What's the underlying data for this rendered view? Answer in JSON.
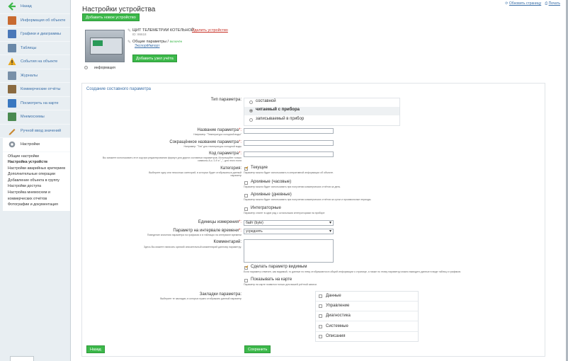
{
  "sidebar": {
    "back": "Назад",
    "items": [
      {
        "label": "Информация об объекте",
        "color": "#c86a30"
      },
      {
        "label": "Графики и диаграммы",
        "color": "#4a78b8"
      },
      {
        "label": "Таблицы",
        "color": "#6a88a8"
      },
      {
        "label": "События на объекте",
        "color": "#e8a820"
      },
      {
        "label": "Журналы",
        "color": "#7890a8"
      },
      {
        "label": "Коммерческие отчёты",
        "color": "#8a6a40"
      },
      {
        "label": "Посмотреть на карте",
        "color": "#3a78c0"
      },
      {
        "label": "Мнемосхемы",
        "color": "#4a8a50"
      },
      {
        "label": "Ручной ввод значений",
        "color": "#c88830"
      }
    ],
    "settings": "Настройки",
    "submenu": [
      "Общие настройки",
      "Настройка устройств",
      "Настройки аварийных критериев",
      "Дополнительные операции",
      "Добавление объекта в группу",
      "Настройки доступа",
      "Настройка мнемосхем и",
      "коммерческих отчётов",
      "Фотографии и документация"
    ]
  },
  "header": {
    "title": "Настройки устройства",
    "refresh": "Обновить страницу",
    "print": "Печать"
  },
  "device": {
    "add_device": "Добавить новое устройство",
    "name": "ЩИТ ТЕЛЕМЕТРИИ КОТЕЛЬНОЙ",
    "id": "ID: 86618",
    "delete": "Удалить устройство",
    "common_params": "Общие параметры",
    "enabled": "включён",
    "export": "Экспорт",
    "import": "Импорт",
    "add_node": "Добавить узел учёта",
    "info": "информация"
  },
  "form": {
    "title": "Создание составного параметра",
    "type_label": "Тип параметра:",
    "types": [
      "составной",
      "читаемый с прибора",
      "записываемый в прибор"
    ],
    "name_label": "Название параметра",
    "name_hint": "Например: \"Температура холодной воды\"",
    "short_label": "Сокращённое название параметра",
    "short_hint": "Например: \"Тхв\" для температуры холодной воды",
    "code_label": "Код параметра",
    "code_hint1": "Вы сможете использовать этот код при редактировании формул для других составных параметров. Используйте только",
    "code_hint2": "символы A-z, 0-9 и \"_\", для этого поля",
    "req": "*:",
    "cat_label": "Категория:",
    "cat_hint1": "Выберите одну или несколько категорий, в которых будет отображаться данный",
    "cat_hint2": "параметр",
    "cats": [
      {
        "label": "Текущие",
        "hint": "Параметр можно будет использовать в оперативной информации об объекте.",
        "checked": true
      },
      {
        "label": "Архивные (часовые)",
        "hint": "Параметр можно будет использовать при получении коммерческих отчётов за день.",
        "checked": false
      },
      {
        "label": "Архивные (дневные)",
        "hint": "Параметр можно будет использовать при получении коммерческих отчётов за сутки и произвольные периоды.",
        "checked": false
      },
      {
        "label": "Интегрaторные",
        "hint": "Параметр станет в один ряд с остальными интеграторами на приборе",
        "checked": false
      }
    ],
    "unit_label": "Единицы измерения",
    "unit_value": "байт (byte)",
    "interval_label": "Параметр на интервале времени",
    "interval_hint": "Поведение значения параметра на графиках и в таблицах на интервале времени",
    "interval_value": "усреднять",
    "comment_label": "Комментарий:",
    "comment_hint": "Здесь Вы можете написать краткий описательный комментарий данному параметру.",
    "visible_label": "Сделать параметр видимым",
    "visible_hint": "Если параметр отмечен, как видимый, то данные по нему отображаются в общей информации о странице, а также по этому параметру можно выводить данные в виде таблиц и графиков.",
    "map_label": "Показывать на карте",
    "map_hint": "Параметр на карте появится только для вашей учётной записи.",
    "tabs_label": "Закладки параметра:",
    "tabs_hint": "Выберите те закладки, в которых нужно отображать данный параметр",
    "tabs": [
      "Данные",
      "Управление",
      "Диагностика",
      "Системные",
      "Описания"
    ],
    "back": "Назад",
    "save": "Сохранить"
  }
}
